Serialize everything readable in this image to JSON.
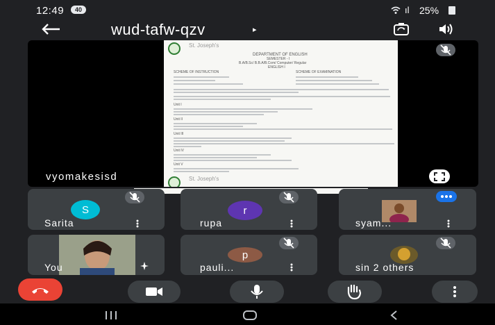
{
  "status_bar": {
    "time": "12:49",
    "badge": "40",
    "signal": "ıl",
    "battery": "25%"
  },
  "meeting": {
    "code": "wud-tafw-qzv",
    "caret": "▸"
  },
  "presentation": {
    "presenter_name": "vyomakesisd",
    "doc": {
      "college_top": "St. Joseph's",
      "college_bottom": "St. Joseph's",
      "department": "DEPARTMENT OF ENGLISH",
      "semester": "SEMESTER - I",
      "program": "B.A/B.Sc/ B.B.A/B.Com/ Computer/ Regular",
      "course_title": "ENGLISH I",
      "scheme_instruction": "SCHEME OF INSTRUCTION",
      "scheme_exam": "SCHEME OF EXAMINATION",
      "unit1": "Unit I",
      "unit2": "Unit II",
      "unit3": "Unit III",
      "unit4": "Unit IV",
      "unit5": "Unit V",
      "lang_dev": "Lang Dev: Essay Writing",
      "ref_books": "Reference Books"
    }
  },
  "participants": [
    {
      "name": "Sarita",
      "initial": "S",
      "color": "#00bcd4"
    },
    {
      "name": "rupa",
      "initial": "r",
      "color": "#5e35b1"
    },
    {
      "name": "syam...",
      "initial": "",
      "color": ""
    },
    {
      "name": "You",
      "initial": "",
      "color": ""
    },
    {
      "name": "pauli...",
      "initial": "p",
      "color": "#8d5a45"
    },
    {
      "name": "sin 2 others",
      "initial": "",
      "color": ""
    }
  ],
  "icons": {
    "back": "arrow-left-icon",
    "camera_flip": "camera-flip-icon",
    "speaker": "speaker-icon",
    "mic_off": "mic-off-icon",
    "fullscreen": "fullscreen-icon",
    "more": "more-vert-icon",
    "end_call": "end-call-icon",
    "camera": "camera-icon",
    "mic": "mic-icon",
    "hand": "raise-hand-icon",
    "effects": "sparkle-icon",
    "talking": "talking-dots-icon"
  },
  "colors": {
    "end_call": "#ea4335",
    "tile": "#3c4043",
    "background": "#202124",
    "speaking": "#1a73e8"
  }
}
